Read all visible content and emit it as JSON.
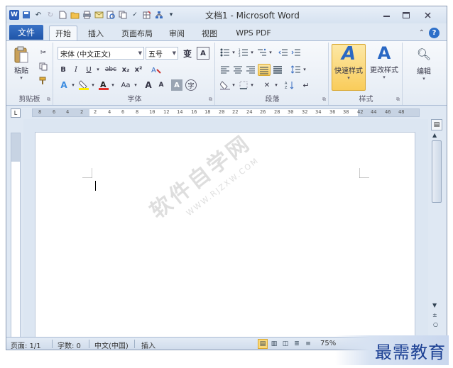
{
  "window": {
    "title": "文档1 - Microsoft Word"
  },
  "qat": {
    "icons": [
      "word-logo-icon",
      "save-icon",
      "undo-icon",
      "redo-icon",
      "new-doc-icon",
      "open-folder-icon",
      "print-icon",
      "email-icon",
      "print-preview-icon",
      "copy-icon",
      "spell-check-icon",
      "draw-table-icon",
      "org-chart-icon",
      "customize-qat-icon"
    ]
  },
  "tabs": {
    "file": "文件",
    "items": [
      "开始",
      "插入",
      "页面布局",
      "审阅",
      "视图",
      "WPS PDF"
    ],
    "active": "开始"
  },
  "ribbon": {
    "clipboard": {
      "paste": "粘贴",
      "group": "剪贴板"
    },
    "font": {
      "font_name": "宋体 (中文正文)",
      "font_size": "五号",
      "bold": "B",
      "italic": "I",
      "underline": "U",
      "strike": "abc",
      "sub": "x₂",
      "sup": "x²",
      "change_case": "Aa",
      "grow": "A",
      "shrink": "A",
      "group": "字体"
    },
    "paragraph": {
      "group": "段落"
    },
    "styles": {
      "quick": "快速样式",
      "change": "更改样式",
      "group": "样式"
    },
    "editing": {
      "label": "编辑"
    }
  },
  "ruler": {
    "numbers": [
      "8",
      "6",
      "4",
      "2",
      "2",
      "4",
      "6",
      "8",
      "10",
      "12",
      "14",
      "16",
      "18",
      "20",
      "22",
      "24",
      "26",
      "28",
      "30",
      "32",
      "34",
      "36",
      "38",
      "42",
      "44",
      "46",
      "48"
    ]
  },
  "document": {
    "watermark": "软件自学网",
    "watermark_url": "WWW.RJZXW.COM"
  },
  "status": {
    "page": "页面: 1/1",
    "words": "字数: 0",
    "lang": "中文(中国)",
    "mode": "插入",
    "zoom": "75%"
  },
  "brand": {
    "text": "最需教育"
  },
  "colors": {
    "file_tab": "#1f55a8",
    "accent_active": "#f9cc5a",
    "brand_text": "#1b3f93"
  }
}
